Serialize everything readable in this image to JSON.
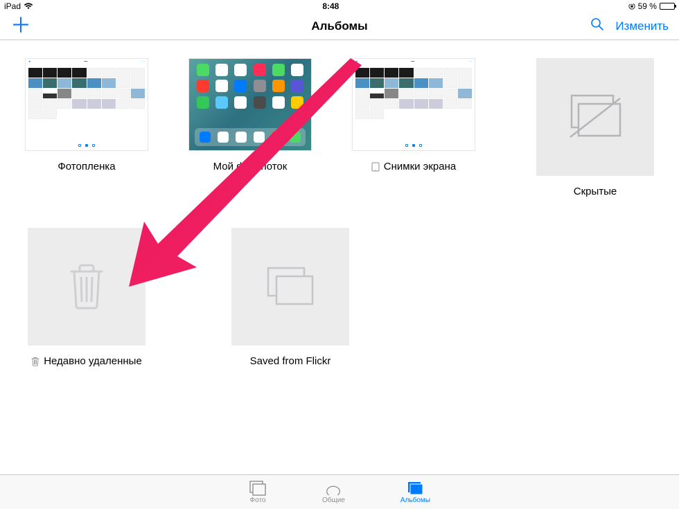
{
  "status": {
    "device": "iPad",
    "time": "8:48",
    "battery_text": "59 %",
    "battery_level": 59
  },
  "nav": {
    "title": "Альбомы",
    "edit_label": "Изменить"
  },
  "albums": [
    {
      "id": "camera-roll",
      "label": "Фотопленка",
      "thumb": "gallery"
    },
    {
      "id": "photostream",
      "label": "Мой фотопоток",
      "thumb": "ipad"
    },
    {
      "id": "screenshots",
      "label": "Снимки экрана",
      "thumb": "gallery",
      "prefix_icon": "device"
    },
    {
      "id": "hidden",
      "label": "Скрытые",
      "thumb": "hidden-placeholder"
    },
    {
      "id": "recently-deleted",
      "label": "Недавно удаленные",
      "thumb": "trash-placeholder",
      "prefix_icon": "trash"
    },
    {
      "id": "saved-flickr",
      "label": "Saved from Flickr",
      "thumb": "stack-placeholder"
    }
  ],
  "tabs": {
    "photos": "Фото",
    "shared": "Общие",
    "albums": "Альбомы",
    "active": "albums"
  },
  "colors": {
    "accent": "#007aff",
    "arrow": "#e91e63"
  }
}
